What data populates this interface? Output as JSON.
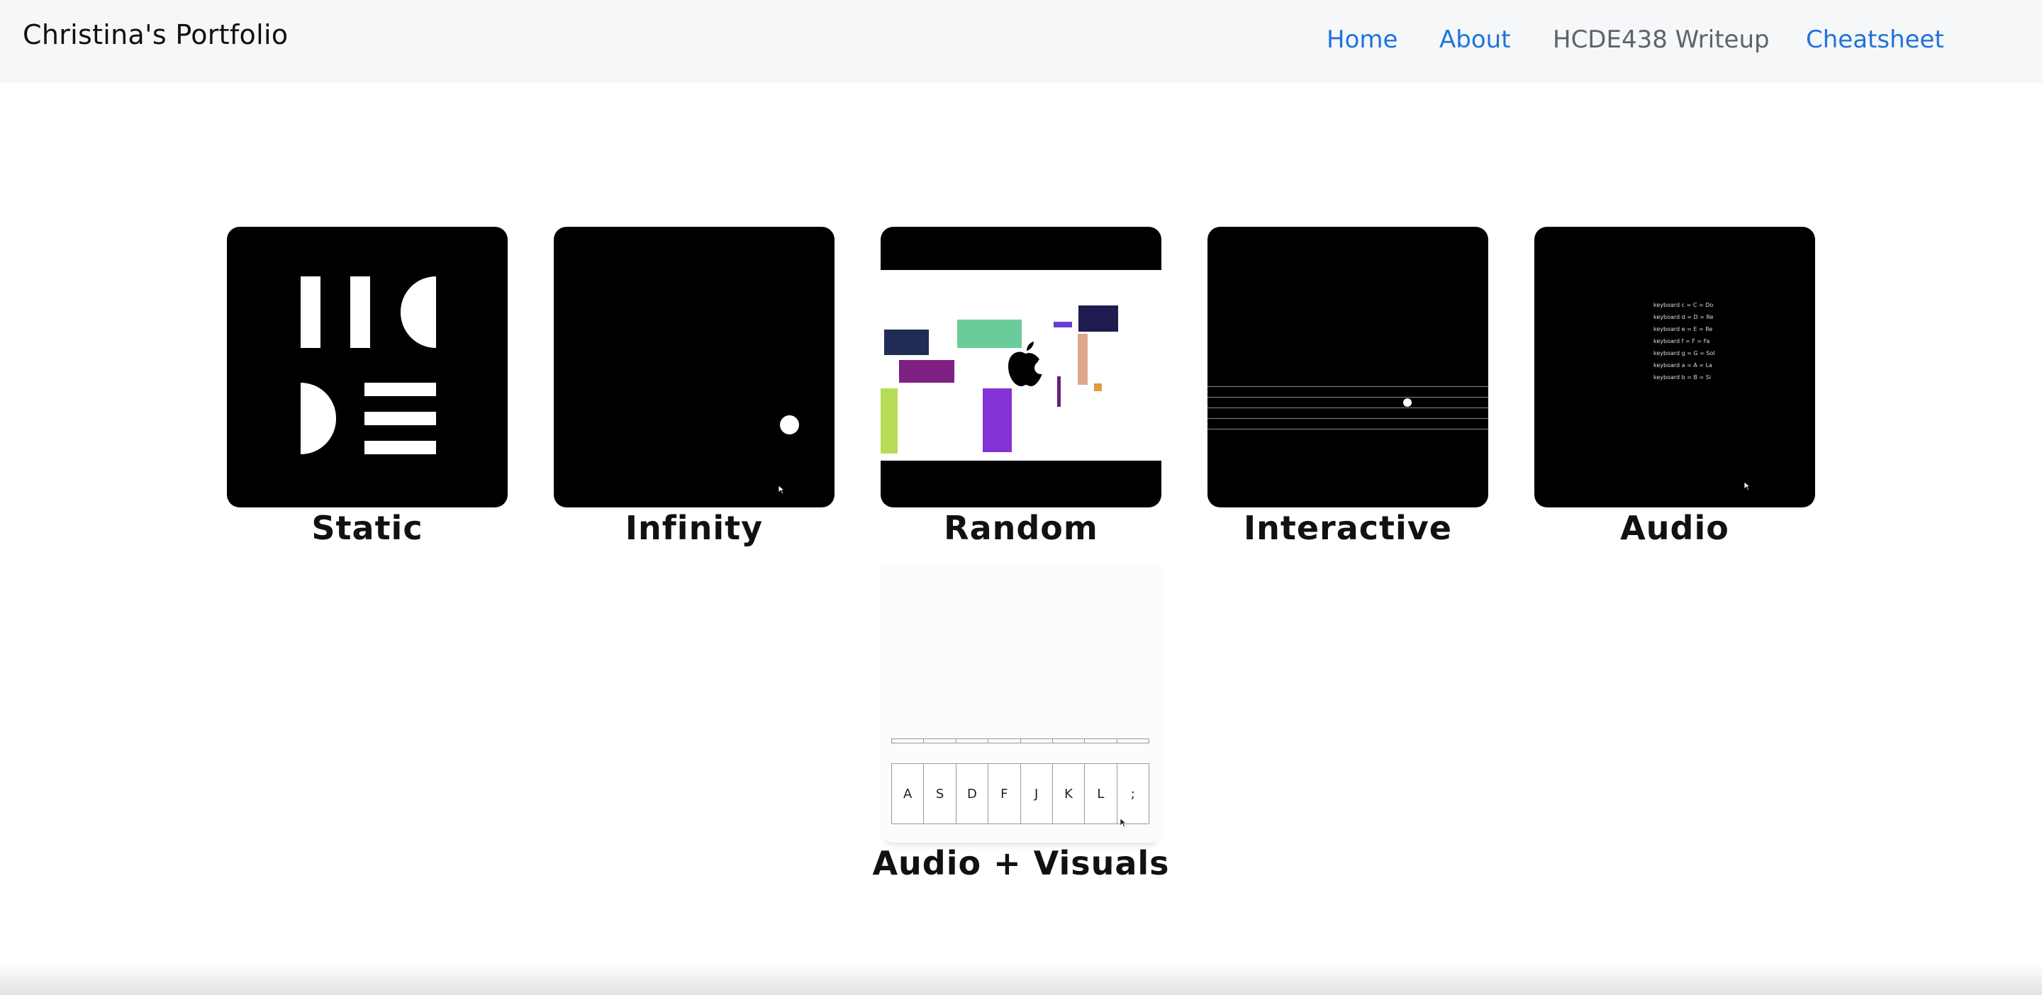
{
  "navbar": {
    "brand": "Christina's Portfolio",
    "links": [
      {
        "label": "Home",
        "active": false
      },
      {
        "label": "About",
        "active": false
      },
      {
        "label": "HCDE438 Writeup",
        "active": true
      },
      {
        "label": "Cheatsheet",
        "active": false
      }
    ]
  },
  "projects": [
    {
      "title": "Static"
    },
    {
      "title": "Infinity"
    },
    {
      "title": "Random"
    },
    {
      "title": "Interactive"
    },
    {
      "title": "Audio",
      "keyboard_lines": [
        "keyboard c = C = Do",
        "keyboard d = D = Re",
        "keyboard e = E = Re",
        "keyboard f = F = Fa",
        "keyboard g = G = Sol",
        "keyboard a = A = La",
        "keyboard b = B = Si"
      ]
    },
    {
      "title": "Audio + Visuals",
      "keys": [
        "A",
        "S",
        "D",
        "F",
        "J",
        "K",
        "L",
        ";"
      ]
    }
  ],
  "colors": {
    "link": "#1f73dc",
    "link_active": "#5f6368",
    "navbar_bg": "#f6f7f8",
    "thumb_bg": "#000000"
  }
}
